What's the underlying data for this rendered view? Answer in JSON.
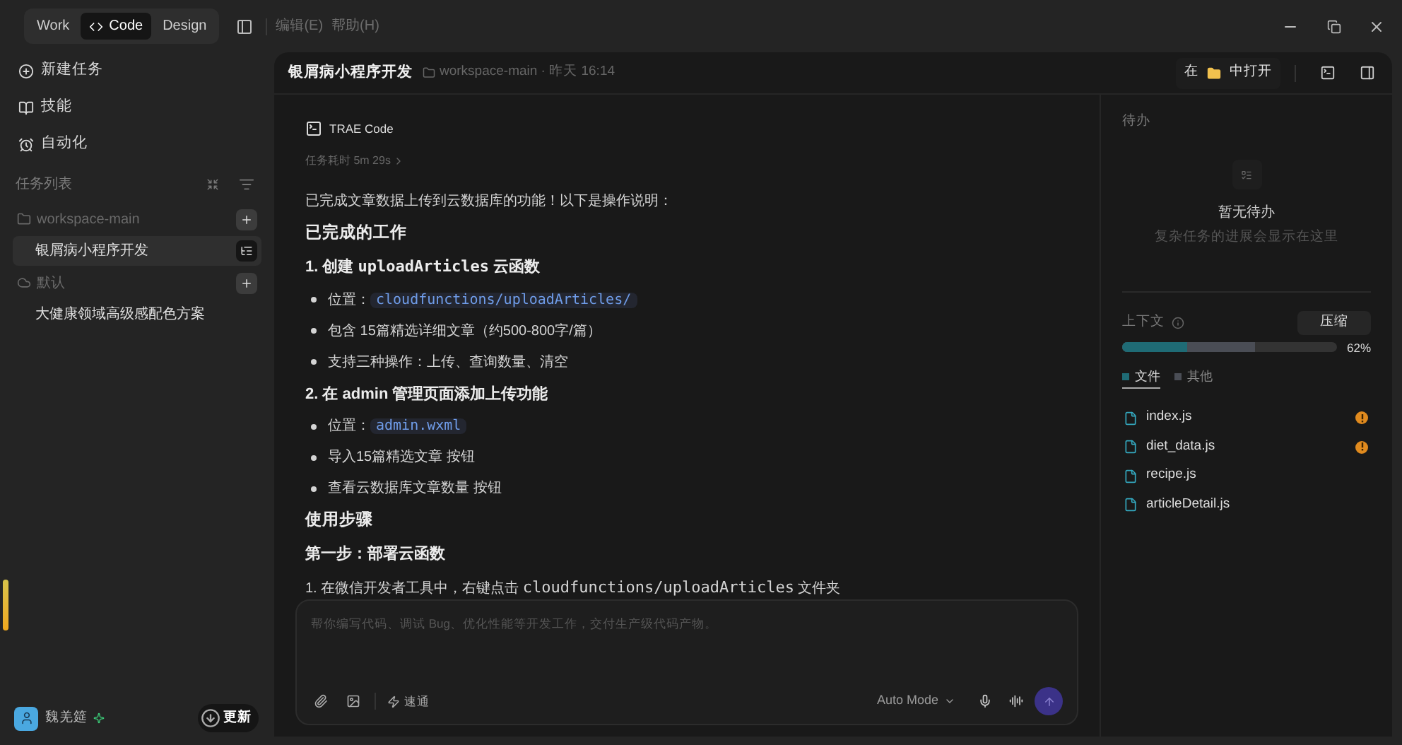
{
  "mode_tabs": [
    {
      "label": "Work",
      "selected": false,
      "icon": false
    },
    {
      "label": "Code",
      "selected": true,
      "icon": true
    },
    {
      "label": "Design",
      "selected": false,
      "icon": false
    }
  ],
  "menu": [
    "编辑(E)",
    "帮助(H)"
  ],
  "nav": [
    {
      "label": "新建任务",
      "kind": "new"
    },
    {
      "label": "技能",
      "kind": "skills"
    },
    {
      "label": "自动化",
      "kind": "auto"
    }
  ],
  "task_list": {
    "title": "任务列表",
    "groups": [
      {
        "name": "workspace-main",
        "kind": "folder",
        "tasks": [
          {
            "label": "银屑病小程序开发",
            "selected": true
          }
        ]
      },
      {
        "name": "默认",
        "kind": "cloud",
        "tasks": [
          {
            "label": "大健康领域高级感配色方案",
            "selected": false
          }
        ]
      }
    ]
  },
  "user": {
    "name": "魏羌筵"
  },
  "update_button": "更新",
  "header": {
    "title": "银屑病小程序开发",
    "workspace": "workspace-main · 昨天 16:14",
    "open_in_left": "在",
    "open_in_right": "中打开"
  },
  "agent": {
    "name": "TRAE Code",
    "duration": "任务耗时 5m 29s"
  },
  "message": [
    {
      "kind": "paragraph",
      "parts": [
        {
          "text": "已完成文章数据上传到云数据库的功能！以下是操作说明：",
          "code": false
        }
      ]
    },
    {
      "kind": "heading",
      "parts": [
        {
          "text": "已完成的工作",
          "code": false
        }
      ]
    },
    {
      "kind": "subheading",
      "parts": [
        {
          "text": "1. 创建 ",
          "code": false
        },
        {
          "text": "uploadArticles",
          "code": true
        },
        {
          "text": " 云函数",
          "code": false
        }
      ]
    },
    {
      "kind": "bullet",
      "parts": [
        {
          "text": "位置：",
          "code": false
        },
        {
          "text": "cloudfunctions/uploadArticles/",
          "code": true
        }
      ]
    },
    {
      "kind": "bullet",
      "parts": [
        {
          "text": "包含 15篇精选详细文章（约500-800字/篇）",
          "code": false
        }
      ]
    },
    {
      "kind": "bullet",
      "parts": [
        {
          "text": "支持三种操作：上传、查询数量、清空",
          "code": false
        }
      ]
    },
    {
      "kind": "subheading",
      "parts": [
        {
          "text": "2. 在 admin 管理页面添加上传功能",
          "code": false
        }
      ]
    },
    {
      "kind": "bullet",
      "parts": [
        {
          "text": "位置：",
          "code": false
        },
        {
          "text": "admin.wxml",
          "code": true
        }
      ]
    },
    {
      "kind": "bullet",
      "parts": [
        {
          "text": "导入15篇精选文章 按钮",
          "code": false
        }
      ]
    },
    {
      "kind": "bullet",
      "parts": [
        {
          "text": "查看云数据库文章数量 按钮",
          "code": false
        }
      ]
    },
    {
      "kind": "heading",
      "parts": [
        {
          "text": "使用步骤",
          "code": false
        }
      ]
    },
    {
      "kind": "subheading",
      "parts": [
        {
          "text": "第一步：部署云函数",
          "code": false
        }
      ]
    },
    {
      "kind": "paragraph",
      "parts": [
        {
          "text": "1. 在微信开发者工具中，右键点击 ",
          "code": false
        },
        {
          "text": "cloudfunctions/uploadArticles",
          "code": true
        },
        {
          "text": " 文件夹",
          "code": false
        }
      ]
    }
  ],
  "composer": {
    "placeholder": "帮你编写代码、调试 Bug、优化性能等开发工作，交付生产级代码产物。",
    "quick_label": "速通",
    "mode": "Auto Mode"
  },
  "todo": {
    "title": "待办",
    "empty_title": "暂无待办",
    "empty_hint": "复杂任务的进展会显示在这里"
  },
  "context": {
    "title": "上下文",
    "compress_button": "压缩",
    "percent": "62%",
    "segments": [
      {
        "label": "文件",
        "level": 0.3,
        "color": "#1f6b75",
        "selected": true
      },
      {
        "label": "其他",
        "level": 0.62,
        "color": "#4a4d55",
        "selected": false
      }
    ]
  },
  "files": [
    {
      "name": "index.js",
      "warning": true
    },
    {
      "name": "diet_data.js",
      "warning": true
    },
    {
      "name": "recipe.js",
      "warning": false
    },
    {
      "name": "articleDetail.js",
      "warning": false
    }
  ]
}
